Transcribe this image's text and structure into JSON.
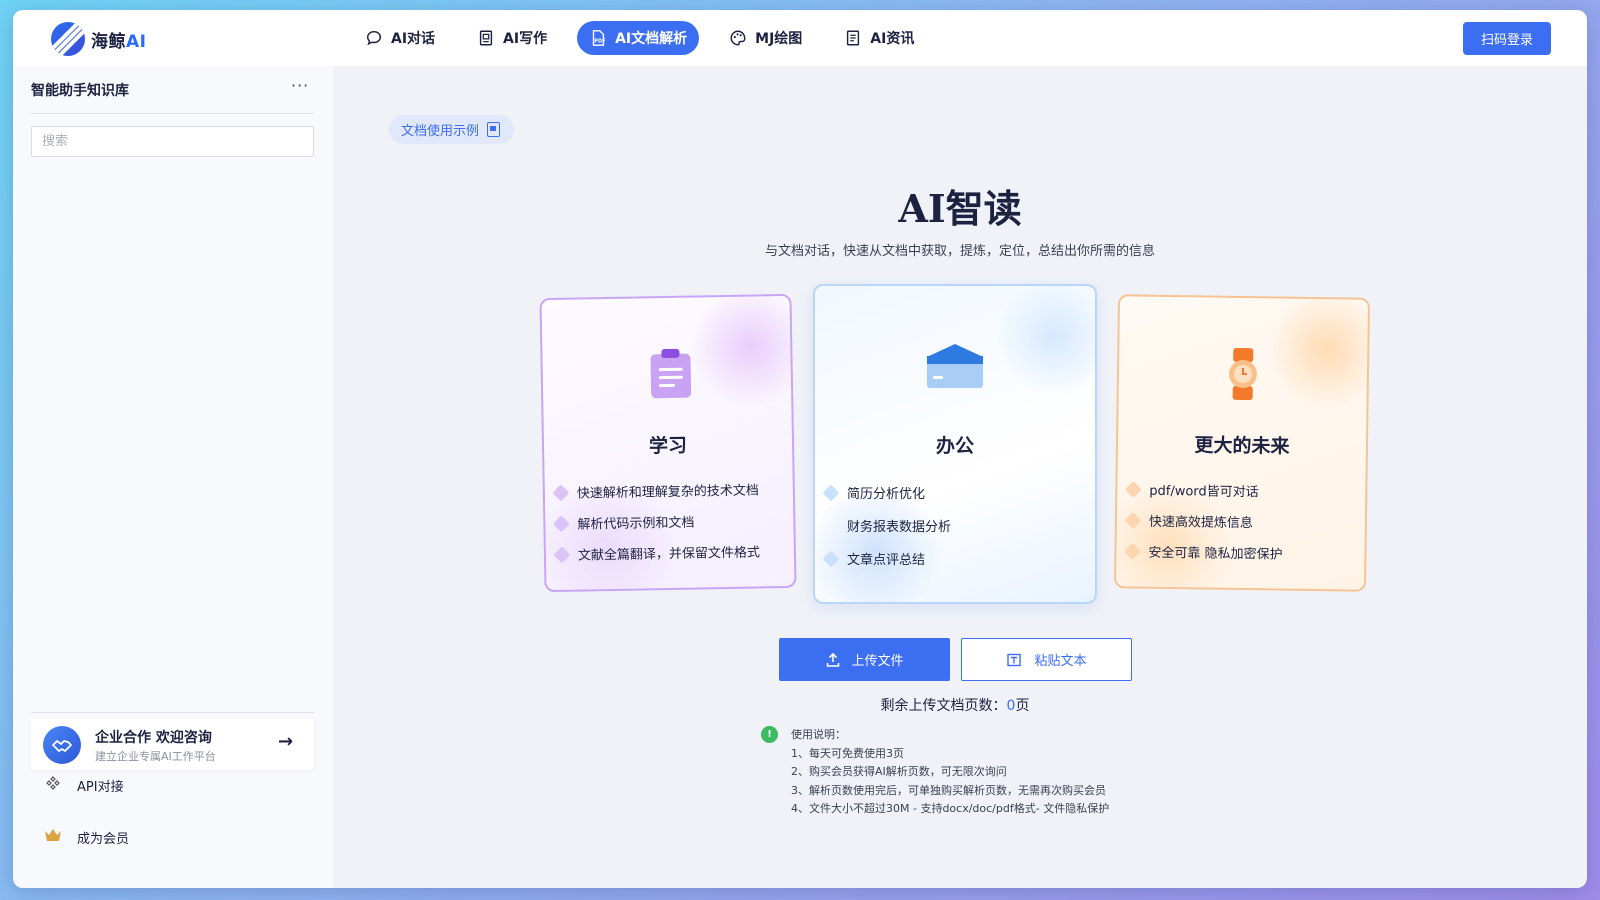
{
  "header": {
    "logo_text": "海鲸",
    "logo_ai": "AI",
    "nav": [
      {
        "label": "AI对话"
      },
      {
        "label": "AI写作"
      },
      {
        "label": "AI文档解析"
      },
      {
        "label": "MJ绘图"
      },
      {
        "label": "AI资讯"
      }
    ],
    "active_nav": "AI文档解析",
    "login_label": "扫码登录"
  },
  "sidebar": {
    "title": "智能助手知识库",
    "more": "···",
    "search_placeholder": "搜索",
    "enterprise": {
      "title": "企业合作 欢迎咨询",
      "subtitle": "建立企业专属AI工作平台",
      "arrow": "→"
    },
    "links": [
      {
        "label": "API对接",
        "icon": "api-icon"
      },
      {
        "label": "成为会员",
        "icon": "crown-icon"
      }
    ]
  },
  "main": {
    "sample_tag": "文档使用示例",
    "title": "AI智读",
    "subtitle": "与文档对话，快速从文档中获取，提炼，定位，总结出你所需的信息",
    "cards": [
      {
        "title": "学习",
        "items": [
          "快速解析和理解复杂的技术文档",
          "解析代码示例和文档",
          "文献全篇翻译，并保留文件格式"
        ]
      },
      {
        "title": "办公",
        "items": [
          "简历分析优化",
          "财务报表数据分析",
          "文章点评总结"
        ]
      },
      {
        "title": "更大的未来",
        "items": [
          "pdf/word皆可对话",
          "快速高效提炼信息",
          "安全可靠 隐私加密保护"
        ]
      }
    ],
    "upload_label": "上传文件",
    "paste_label": "粘贴文本",
    "remain_prefix": "剩余上传文档页数：",
    "remain_count": "0",
    "remain_suffix": "页",
    "notes_title": "使用说明：",
    "notes": [
      "1、每天可免费使用3页",
      "2、购买会员获得AI解析页数，可无限次询问",
      "3、解析页数使用完后，可单独购买解析页数，无需再次购买会员",
      "4、文件大小不超过30M - 支持docx/doc/pdf格式- 文件隐私保护"
    ]
  },
  "colors": {
    "accent": "#3b6ef0",
    "learn": "#c9a6f5",
    "office": "#b8d6f8",
    "future": "#f6c494",
    "info": "#3dbb62"
  }
}
